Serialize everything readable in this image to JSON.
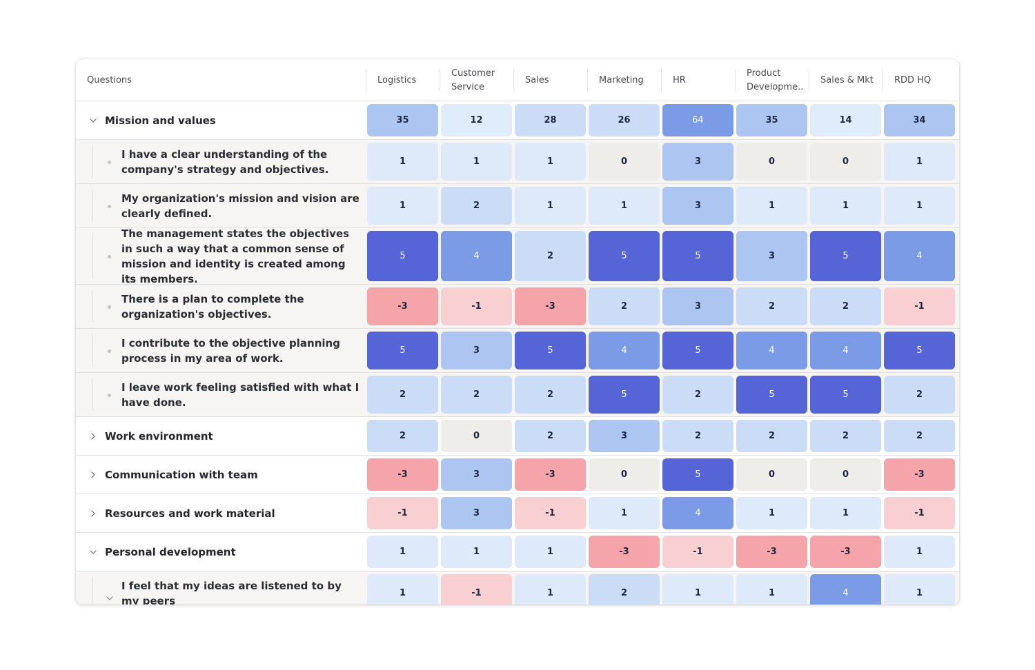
{
  "table": {
    "question_header": "Questions",
    "departments": [
      "Logistics",
      "Customer Service",
      "Sales",
      "Marketing",
      "HR",
      "Product Developme...",
      "Sales & Mkt",
      "RDD HQ"
    ],
    "rows": [
      {
        "type": "group",
        "expanded": true,
        "icon": "chevron-down-icon",
        "label": "Mission and values",
        "values": [
          35,
          12,
          28,
          26,
          64,
          35,
          14,
          34
        ]
      },
      {
        "type": "child",
        "label": "I have a clear understanding of the company's strategy and objectives.",
        "values": [
          1,
          1,
          1,
          0,
          3,
          0,
          0,
          1
        ]
      },
      {
        "type": "child",
        "label": "My organization's mission and vision are clearly defined.",
        "values": [
          1,
          2,
          1,
          1,
          3,
          1,
          1,
          1
        ]
      },
      {
        "type": "child",
        "label": "The management states the objectives in such a way that a common sense of mission and identity is created among its members.",
        "values": [
          5,
          4,
          2,
          5,
          5,
          3,
          5,
          4
        ]
      },
      {
        "type": "child",
        "label": "There is a plan to complete the organization's objectives.",
        "values": [
          -3,
          -1,
          -3,
          2,
          3,
          2,
          2,
          -1
        ]
      },
      {
        "type": "child",
        "label": "I contribute to the objective planning process in my area of work.",
        "values": [
          5,
          3,
          5,
          4,
          5,
          4,
          4,
          5
        ]
      },
      {
        "type": "child",
        "label": "I leave work feeling satisfied with what I have done.",
        "values": [
          2,
          2,
          2,
          5,
          2,
          5,
          5,
          2
        ]
      },
      {
        "type": "group",
        "expanded": false,
        "icon": "chevron-right-icon",
        "label": "Work environment",
        "values": [
          2,
          0,
          2,
          3,
          2,
          2,
          2,
          2
        ]
      },
      {
        "type": "group",
        "expanded": false,
        "icon": "chevron-right-icon",
        "label": "Communication with team",
        "values": [
          -3,
          3,
          -3,
          0,
          5,
          0,
          0,
          -3
        ]
      },
      {
        "type": "group",
        "expanded": false,
        "icon": "chevron-right-icon",
        "label": "Resources and work material",
        "values": [
          -1,
          3,
          -1,
          1,
          4,
          1,
          1,
          -1
        ]
      },
      {
        "type": "group",
        "expanded": true,
        "icon": "chevron-down-icon",
        "label": "Personal development",
        "values": [
          1,
          1,
          1,
          -3,
          -1,
          -3,
          -3,
          1
        ]
      },
      {
        "type": "child",
        "expandable": true,
        "icon": "chevron-down-icon",
        "label": "I feel that my ideas are listened to by my peers",
        "values": [
          1,
          -1,
          1,
          2,
          1,
          1,
          4,
          1
        ]
      }
    ]
  },
  "colors": {
    "neg3": "#f5a5aa",
    "neg1": "#f8d0d2",
    "zero": "#eeedea",
    "pos1": "#deeafa",
    "pos2": "#cadcf6",
    "pos3": "#adc6f1",
    "pos4": "#7b9be6",
    "pos5": "#5564d6",
    "sum_low": "#e1ecfb",
    "sum_mid": "#cadcf6",
    "sum_high": "#adc6f1",
    "sum_top": "#7b9be6"
  }
}
